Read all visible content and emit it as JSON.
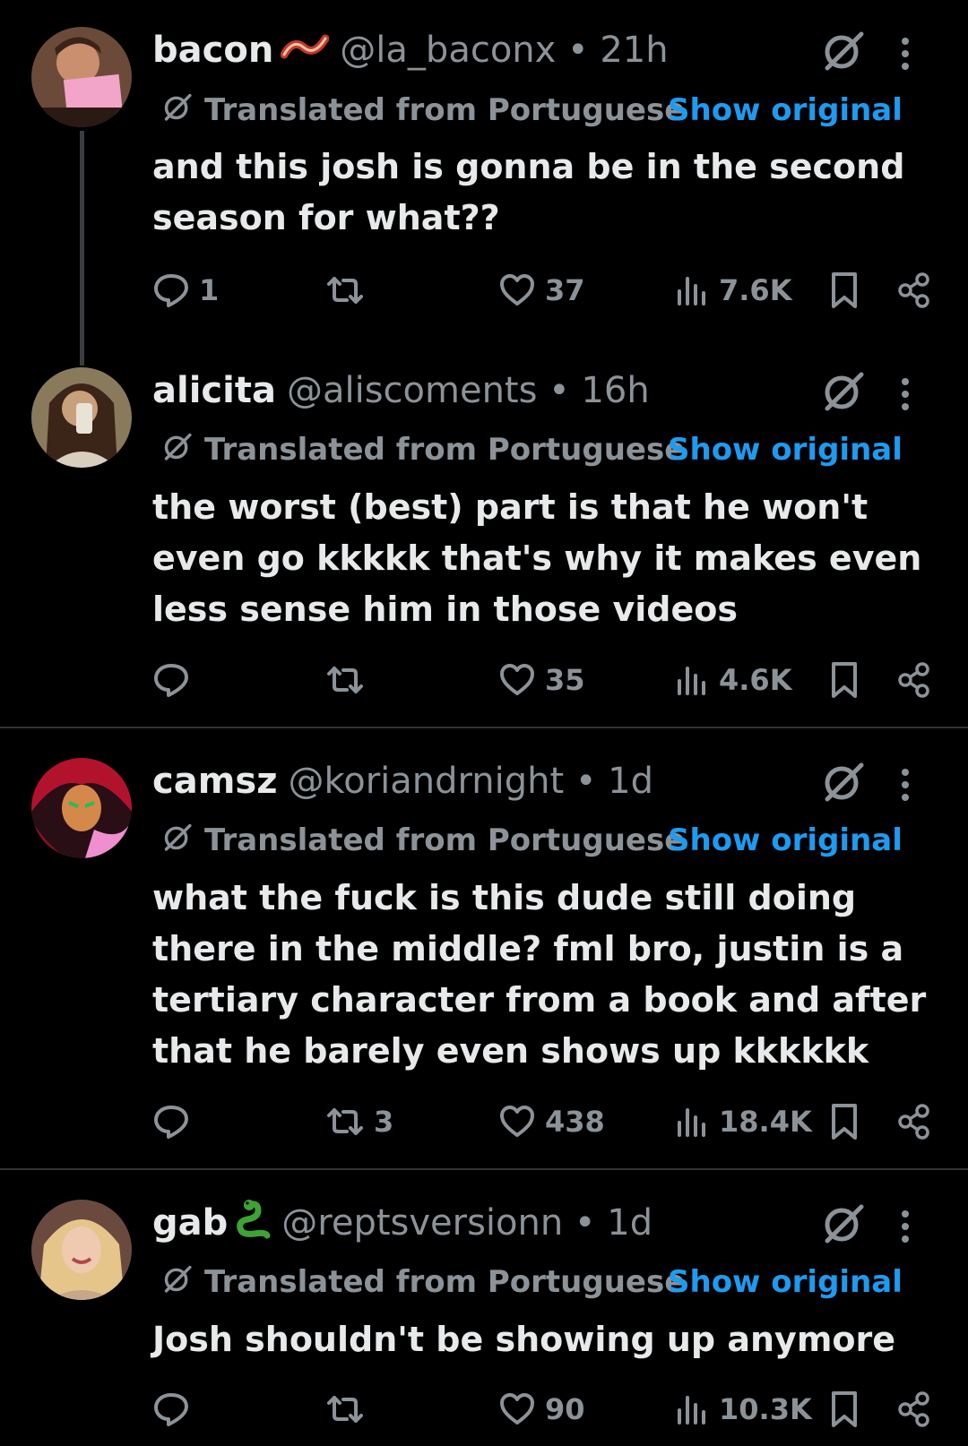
{
  "posts": [
    {
      "name": "bacon",
      "handle": "@la_baconx",
      "time": "21h",
      "emoji_icon": "bacon-emoji",
      "translated_label": "Translated from Portuguese",
      "show_original_label": "Show original",
      "text": "and this josh is gonna be in the second season for what??",
      "replies": "1",
      "reposts": "",
      "likes": "37",
      "views": "7.6K"
    },
    {
      "name": "alicita",
      "handle": "@aliscoments",
      "time": "16h",
      "translated_label": "Translated from Portuguese",
      "show_original_label": "Show original",
      "text": "the worst (best) part is that he won't even go kkkkk that's why it makes even less sense him in those videos",
      "replies": "",
      "reposts": "",
      "likes": "35",
      "views": "4.6K"
    },
    {
      "name": "camsz",
      "handle": "@koriandrnight",
      "time": "1d",
      "translated_label": "Translated from Portuguese",
      "show_original_label": "Show original",
      "text": "what the fuck is this dude still doing there in the middle? fml bro, justin is a tertiary character from a book and after that he barely even shows up kkkkkk",
      "replies": "",
      "reposts": "3",
      "likes": "438",
      "views": "18.4K"
    },
    {
      "name": "gab",
      "handle": "@reptsversionn",
      "time": "1d",
      "emoji_icon": "snake-emoji",
      "translated_label": "Translated from Portuguese",
      "show_original_label": "Show original",
      "text": "Josh shouldn't be showing up anymore",
      "replies": "",
      "reposts": "",
      "likes": "90",
      "views": "10.3K"
    }
  ],
  "separator": " • ",
  "colors": {
    "background": "#000000",
    "text": "#e7e9ea",
    "muted": "#8b9298",
    "link": "#1d9bf0",
    "divider": "#2f3336"
  }
}
